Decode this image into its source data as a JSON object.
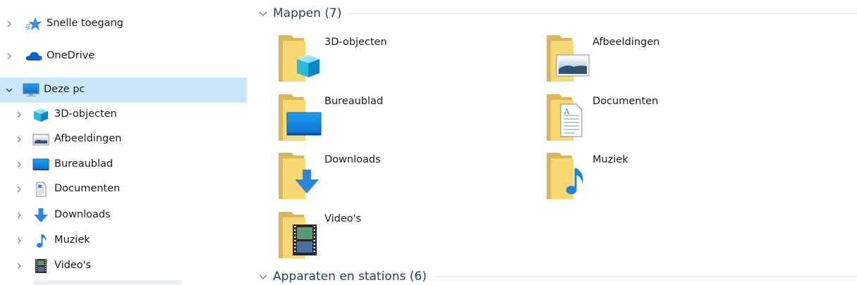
{
  "nav": {
    "items": [
      {
        "label": "Snelle toegang",
        "icon": "star-icon"
      },
      {
        "label": "OneDrive",
        "icon": "cloud-icon"
      },
      {
        "label": "Deze pc",
        "icon": "computer-icon",
        "selected": true,
        "expanded": true
      },
      {
        "label": "3D-objecten",
        "icon": "cube-icon"
      },
      {
        "label": "Afbeeldingen",
        "icon": "picture-icon"
      },
      {
        "label": "Bureaublad",
        "icon": "desktop-icon"
      },
      {
        "label": "Documenten",
        "icon": "document-icon"
      },
      {
        "label": "Downloads",
        "icon": "download-arrow-icon"
      },
      {
        "label": "Muziek",
        "icon": "music-note-icon"
      },
      {
        "label": "Video's",
        "icon": "film-icon"
      }
    ]
  },
  "main": {
    "groups": [
      {
        "title": "Mappen (7)"
      },
      {
        "title": "Apparaten en stations (6)"
      }
    ],
    "folders": [
      {
        "label": "3D-objecten",
        "icon": "cube-icon"
      },
      {
        "label": "Afbeeldingen",
        "icon": "picture-icon"
      },
      {
        "label": "Bureaublad",
        "icon": "desktop-icon"
      },
      {
        "label": "Documenten",
        "icon": "document-icon"
      },
      {
        "label": "Downloads",
        "icon": "download-arrow-icon"
      },
      {
        "label": "Muziek",
        "icon": "music-note-icon"
      },
      {
        "label": "Video's",
        "icon": "film-icon"
      }
    ]
  },
  "colors": {
    "selection": "#cce8ff",
    "group_title": "#1e3f73",
    "folder_back": "#dcb75a",
    "folder_front": "#f8d775",
    "accent_blue": "#1a8ee6"
  }
}
